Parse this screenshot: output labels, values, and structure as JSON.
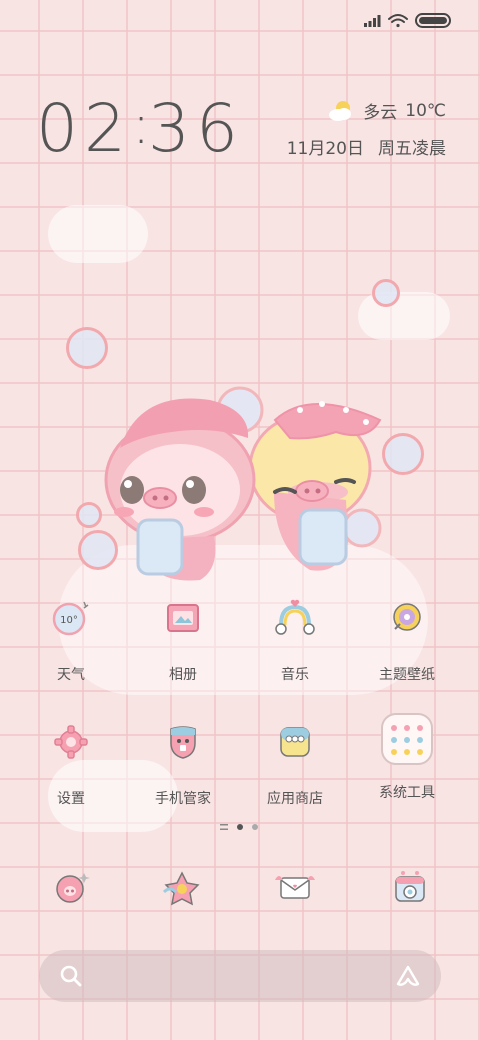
{
  "clock": {
    "hours": "02",
    "minutes": "36"
  },
  "weather": {
    "condition": "多云",
    "temperature": "10℃",
    "icon": "partly-cloudy-icon"
  },
  "date": {
    "date": "11月20日",
    "weekday_period": "周五凌晨"
  },
  "apps": [
    {
      "label": "天气",
      "icon": "weather-icon",
      "icon_text": "10°"
    },
    {
      "label": "相册",
      "icon": "gallery-icon"
    },
    {
      "label": "音乐",
      "icon": "music-icon"
    },
    {
      "label": "主题壁纸",
      "icon": "theme-wallpaper-icon"
    },
    {
      "label": "设置",
      "icon": "settings-icon"
    },
    {
      "label": "手机管家",
      "icon": "phone-manager-icon"
    },
    {
      "label": "应用商店",
      "icon": "app-store-icon"
    },
    {
      "label": "系统工具",
      "icon": "system-tools-folder-icon"
    }
  ],
  "dock": [
    {
      "icon": "phone-icon"
    },
    {
      "icon": "browser-icon"
    },
    {
      "icon": "messages-icon"
    },
    {
      "icon": "camera-icon"
    }
  ],
  "page_indicator": {
    "pages": 2,
    "active": 1
  },
  "colors": {
    "accent_pink": "#f2a0a6",
    "text": "#555555",
    "grid": "#f0c4c7",
    "background": "#f9e4e4"
  }
}
